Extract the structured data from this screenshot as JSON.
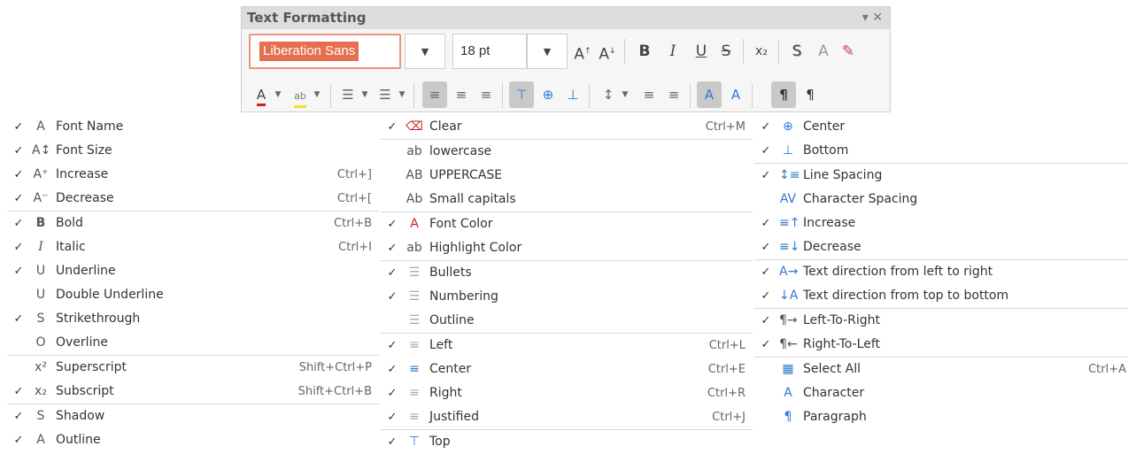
{
  "toolbar": {
    "title": "Text Formatting",
    "window_controls": "▾ ✕",
    "font_name": "Liberation Sans",
    "font_size": "18 pt",
    "dropdown_glyph": "▼"
  },
  "menus": [
    {
      "items": [
        {
          "checked": true,
          "icon": "A",
          "label": "Font Name",
          "shortcut": ""
        },
        {
          "checked": true,
          "icon": "A↕",
          "label": "Font Size",
          "shortcut": ""
        },
        {
          "checked": true,
          "icon": "A⁺",
          "label": "Increase",
          "shortcut": "Ctrl+]"
        },
        {
          "checked": true,
          "icon": "A⁻",
          "label": "Decrease",
          "shortcut": "Ctrl+["
        },
        {
          "divider": true
        },
        {
          "checked": true,
          "icon": "B",
          "label": "Bold",
          "shortcut": "Ctrl+B"
        },
        {
          "checked": true,
          "icon": "I",
          "label": "Italic",
          "shortcut": "Ctrl+I"
        },
        {
          "checked": true,
          "icon": "U",
          "label": "Underline",
          "shortcut": ""
        },
        {
          "checked": false,
          "icon": "U",
          "label": "Double Underline",
          "shortcut": ""
        },
        {
          "checked": true,
          "icon": "S",
          "label": "Strikethrough",
          "shortcut": ""
        },
        {
          "checked": false,
          "icon": "O",
          "label": "Overline",
          "shortcut": ""
        },
        {
          "divider": true
        },
        {
          "checked": false,
          "icon": "x²",
          "label": "Superscript",
          "shortcut": "Shift+Ctrl+P"
        },
        {
          "checked": true,
          "icon": "x₂",
          "label": "Subscript",
          "shortcut": "Shift+Ctrl+B"
        },
        {
          "divider": true
        },
        {
          "checked": true,
          "icon": "S",
          "label": "Shadow",
          "shortcut": ""
        },
        {
          "checked": true,
          "icon": "A",
          "label": "Outline",
          "shortcut": ""
        }
      ]
    },
    {
      "items": [
        {
          "checked": true,
          "icon": "⌫",
          "label": "Clear",
          "shortcut": "Ctrl+M"
        },
        {
          "divider": true
        },
        {
          "checked": false,
          "icon": "ab",
          "label": "lowercase",
          "shortcut": ""
        },
        {
          "checked": false,
          "icon": "AB",
          "label": "UPPERCASE",
          "shortcut": ""
        },
        {
          "checked": false,
          "icon": "Ab",
          "label": "Small capitals",
          "shortcut": ""
        },
        {
          "divider": true
        },
        {
          "checked": true,
          "icon": "A",
          "label": "Font Color",
          "shortcut": ""
        },
        {
          "checked": true,
          "icon": "ab",
          "label": "Highlight Color",
          "shortcut": ""
        },
        {
          "divider": true
        },
        {
          "checked": true,
          "icon": "☰",
          "label": "Bullets",
          "shortcut": ""
        },
        {
          "checked": true,
          "icon": "☰",
          "label": "Numbering",
          "shortcut": ""
        },
        {
          "checked": false,
          "icon": "☰",
          "label": "Outline",
          "shortcut": ""
        },
        {
          "divider": true
        },
        {
          "checked": true,
          "icon": "≡",
          "label": "Left",
          "shortcut": "Ctrl+L"
        },
        {
          "checked": true,
          "icon": "≡",
          "label": "Center",
          "shortcut": "Ctrl+E"
        },
        {
          "checked": true,
          "icon": "≡",
          "label": "Right",
          "shortcut": "Ctrl+R"
        },
        {
          "checked": true,
          "icon": "≡",
          "label": "Justified",
          "shortcut": "Ctrl+J"
        },
        {
          "divider": true
        },
        {
          "checked": true,
          "icon": "⊤",
          "label": "Top",
          "shortcut": ""
        }
      ]
    },
    {
      "items": [
        {
          "checked": true,
          "icon": "⊕",
          "label": "Center",
          "shortcut": ""
        },
        {
          "checked": true,
          "icon": "⊥",
          "label": "Bottom",
          "shortcut": ""
        },
        {
          "divider": true
        },
        {
          "checked": true,
          "icon": "↕≡",
          "label": "Line Spacing",
          "shortcut": ""
        },
        {
          "checked": false,
          "icon": "AV",
          "label": "Character Spacing",
          "shortcut": ""
        },
        {
          "checked": true,
          "icon": "≡↑",
          "label": "Increase",
          "shortcut": ""
        },
        {
          "checked": true,
          "icon": "≡↓",
          "label": "Decrease",
          "shortcut": ""
        },
        {
          "divider": true
        },
        {
          "checked": true,
          "icon": "A→",
          "label": "Text direction from left to right",
          "shortcut": ""
        },
        {
          "checked": true,
          "icon": "↓A",
          "label": "Text direction from top to bottom",
          "shortcut": ""
        },
        {
          "divider": true
        },
        {
          "checked": true,
          "icon": "¶→",
          "label": "Left-To-Right",
          "shortcut": ""
        },
        {
          "checked": true,
          "icon": "¶←",
          "label": "Right-To-Left",
          "shortcut": ""
        },
        {
          "divider": true
        },
        {
          "checked": false,
          "icon": "▦",
          "label": "Select All",
          "shortcut": "Ctrl+A"
        },
        {
          "checked": false,
          "icon": "A",
          "label": "Character",
          "shortcut": ""
        },
        {
          "checked": false,
          "icon": "¶",
          "label": "Paragraph",
          "shortcut": ""
        }
      ]
    }
  ],
  "colors": {
    "font_color_bar": "#cc2222",
    "highlight_bar": "#f5e11f",
    "accent": "#e66f52"
  }
}
